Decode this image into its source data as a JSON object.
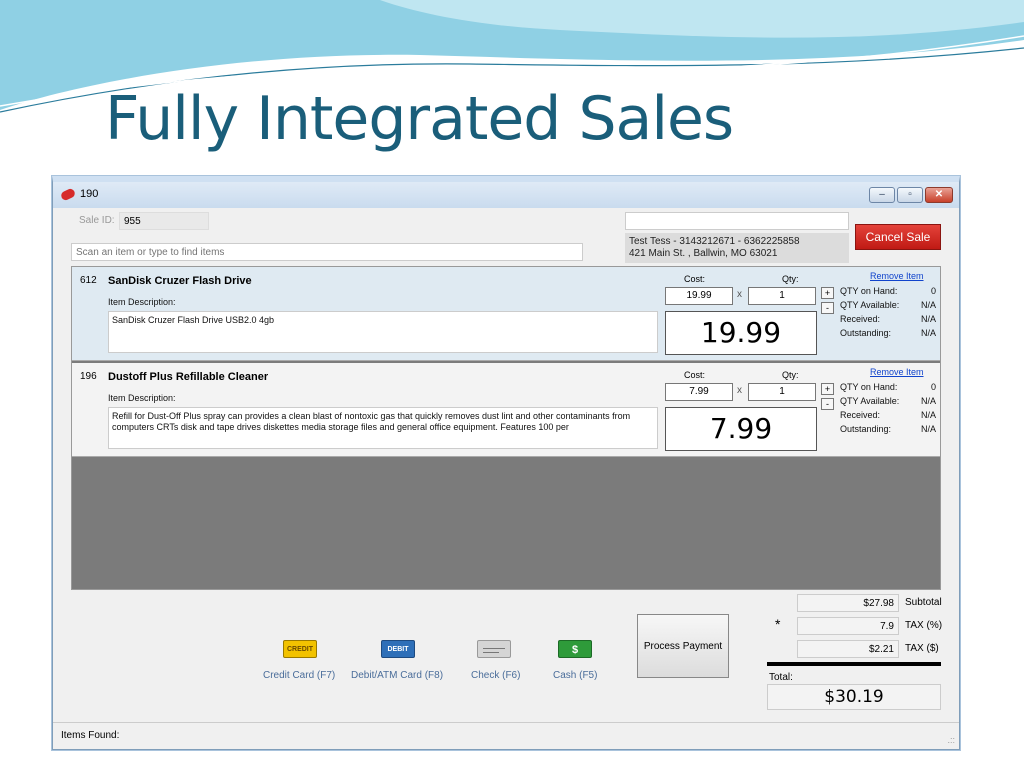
{
  "slide": {
    "title": "Fully Integrated Sales"
  },
  "window": {
    "title": "190",
    "buttons": {
      "minimize": "–",
      "maximize": "▫",
      "close": "✕"
    }
  },
  "header": {
    "sale_id_label": "Sale ID:",
    "sale_id": "955",
    "search_placeholder": "Scan an item or type to find items",
    "customer_line1": "Test Tess - 3143212671 - 6362225858",
    "customer_line2": "421 Main St. , Ballwin, MO 63021",
    "cancel_label": "Cancel Sale"
  },
  "line_items": [
    {
      "id": "612",
      "name": "SanDisk Cruzer Flash Drive",
      "description_label": "Item Description:",
      "description": "SanDisk Cruzer Flash Drive USB2.0 4gb",
      "cost_label": "Cost:",
      "qty_label": "Qty:",
      "cost": "19.99",
      "times": "x",
      "qty": "1",
      "total": "19.99",
      "plus": "+",
      "minus": "-",
      "remove_label": "Remove Item",
      "stock": [
        {
          "label": "QTY on Hand:",
          "value": "0"
        },
        {
          "label": "QTY Available:",
          "value": "N/A"
        },
        {
          "label": "Received:",
          "value": "N/A"
        },
        {
          "label": "Outstanding:",
          "value": "N/A"
        }
      ]
    },
    {
      "id": "196",
      "name": "Dustoff Plus Refillable Cleaner",
      "description_label": "Item Description:",
      "description": "Refill for Dust-Off Plus spray can provides a clean blast of nontoxic gas that quickly removes dust lint and other contaminants from computers CRTs disk and tape drives diskettes media storage files and general office equipment. Features 100 per",
      "cost_label": "Cost:",
      "qty_label": "Qty:",
      "cost": "7.99",
      "times": "x",
      "qty": "1",
      "total": "7.99",
      "plus": "+",
      "minus": "-",
      "remove_label": "Remove Item",
      "stock": [
        {
          "label": "QTY on Hand:",
          "value": "0"
        },
        {
          "label": "QTY Available:",
          "value": "N/A"
        },
        {
          "label": "Received:",
          "value": "N/A"
        },
        {
          "label": "Outstanding:",
          "value": "N/A"
        }
      ]
    }
  ],
  "payment": {
    "methods": [
      {
        "label": "Credit Card (F7)",
        "icon_text": "CREDIT",
        "icon": "credit-card-icon",
        "color": "#f2c200"
      },
      {
        "label": "Debit/ATM Card (F8)",
        "icon_text": "DEBIT",
        "icon": "debit-card-icon",
        "color": "#2e6fb8"
      },
      {
        "label": "Check (F6)",
        "icon_text": "",
        "icon": "check-icon",
        "color": "#c9c9c9"
      },
      {
        "label": "Cash (F5)",
        "icon_text": "$",
        "icon": "cash-icon",
        "color": "#2e9b3a"
      }
    ],
    "process_label": "Process Payment"
  },
  "totals": {
    "subtotal": "$27.98",
    "subtotal_label": "Subtotal",
    "tax_rate": "7.9",
    "tax_rate_label": "TAX (%)",
    "tax": "$2.21",
    "tax_label": "TAX ($)",
    "star": "*",
    "total_label": "Total:",
    "total": "$30.19"
  },
  "status": {
    "text": "Items Found:",
    "grip": ".::"
  }
}
